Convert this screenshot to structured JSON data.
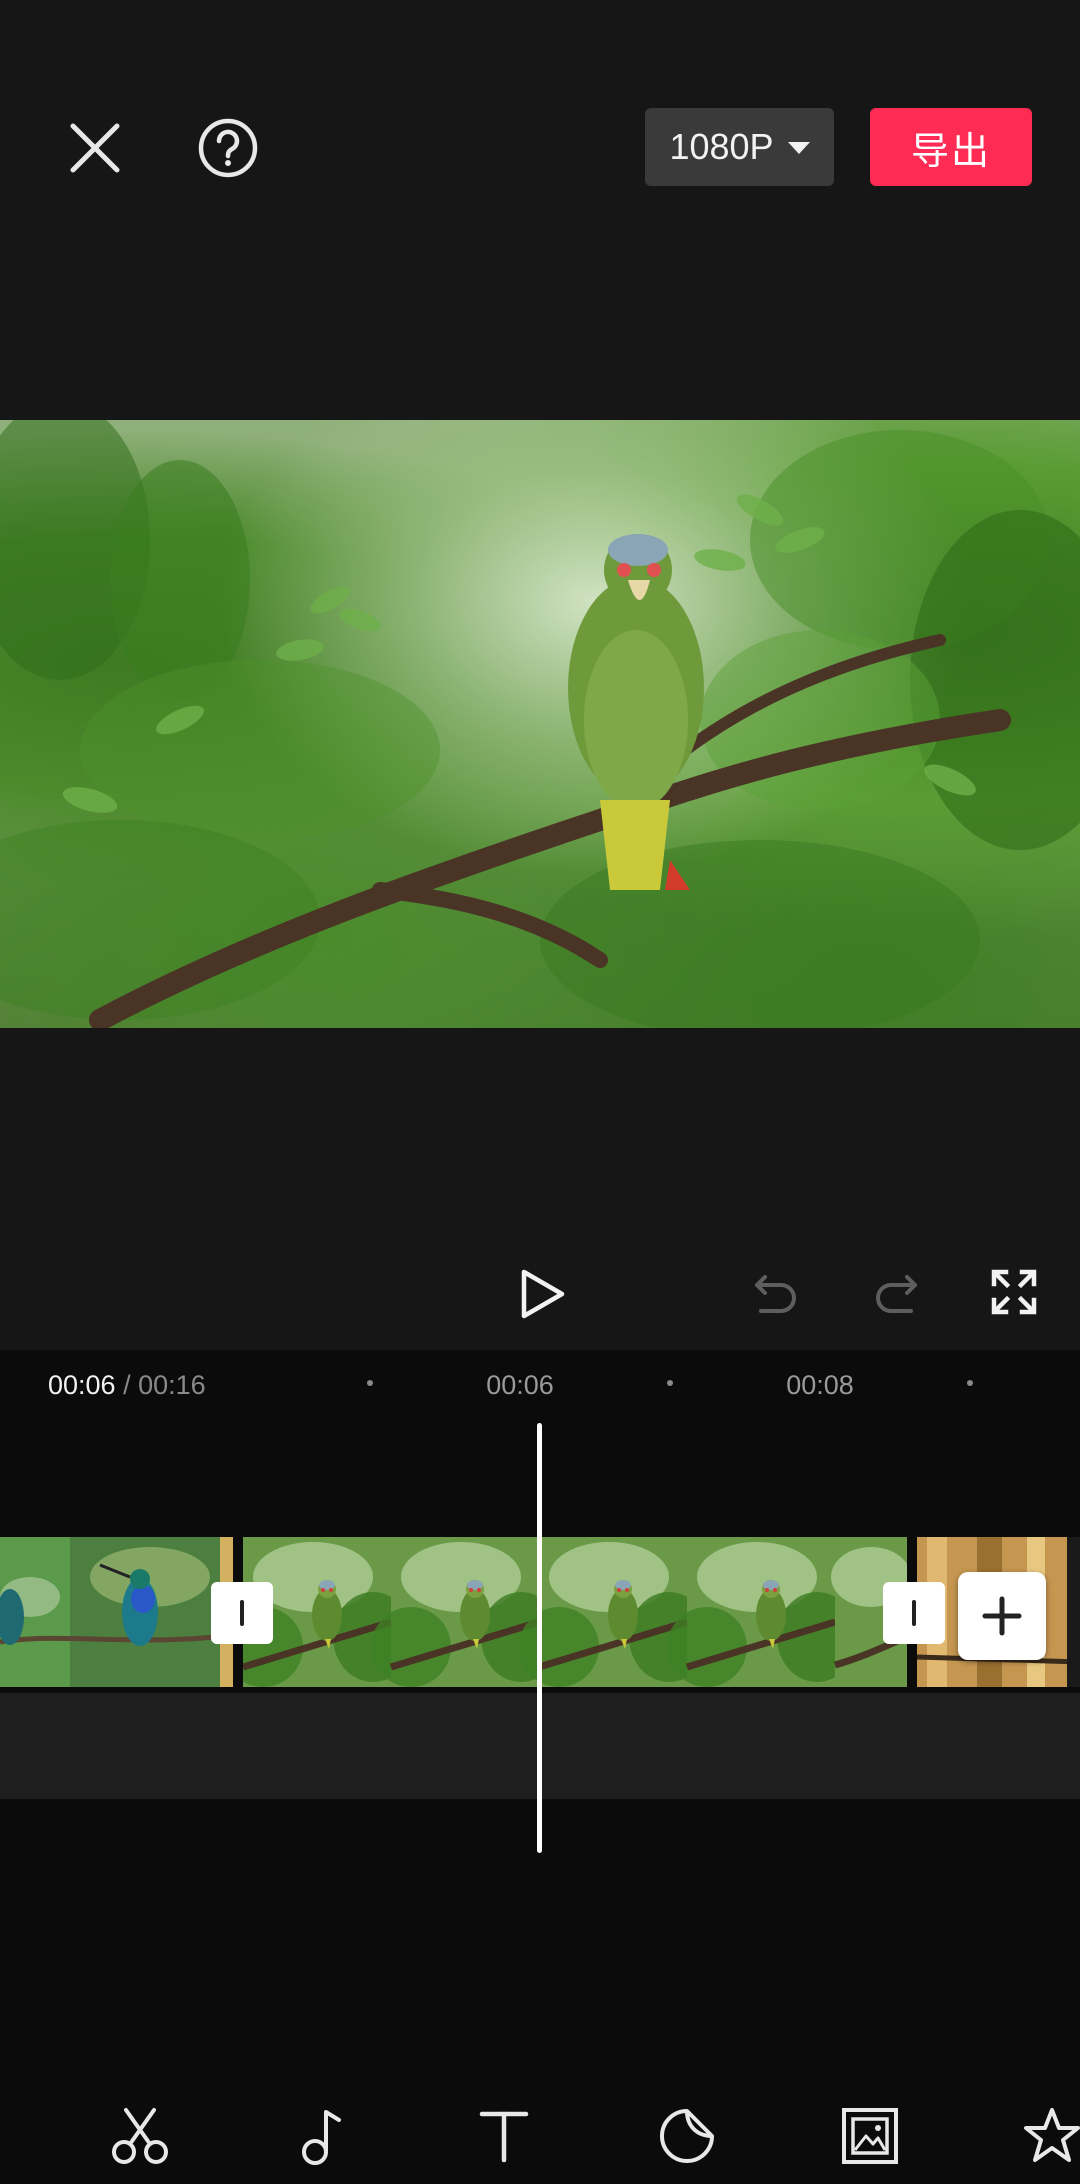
{
  "header": {
    "close_icon": "close-icon",
    "help_icon": "help-icon",
    "resolution": "1080P",
    "export_label": "导出"
  },
  "preview": {
    "subject": "parrot-on-branch-video-frame"
  },
  "controls": {
    "play_icon": "play-icon",
    "undo_icon": "undo-icon",
    "redo_icon": "redo-icon",
    "fullscreen_icon": "fullscreen-icon"
  },
  "timeline": {
    "current_time": "00:06",
    "separator": " / ",
    "total_time": "00:16",
    "ticks": [
      "00:06",
      "00:08"
    ],
    "clips": [
      {
        "name": "hummingbird-clip"
      },
      {
        "name": "parrot-clip"
      },
      {
        "name": "next-clip"
      }
    ],
    "add_clip_icon": "plus-icon"
  },
  "toolbar": {
    "items": [
      "scissors-icon",
      "music-note-icon",
      "text-icon",
      "sticker-icon",
      "image-overlay-icon",
      "effects-icon"
    ]
  },
  "colors": {
    "accent": "#fe2c55",
    "background": "#161616",
    "timeline_bg": "#0b0b0b",
    "resolution_bg": "#3a3a3a"
  }
}
